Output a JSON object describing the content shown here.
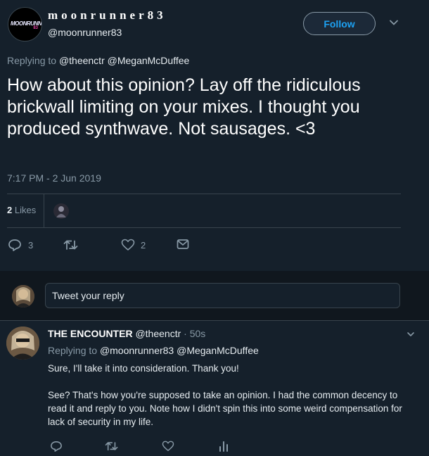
{
  "tweet": {
    "display_name": "moonrunner83",
    "handle": "@moonrunner83",
    "avatar_text": "MOONRUNNER",
    "avatar_badge": "83",
    "follow_label": "Follow",
    "replying_prefix": "Replying to",
    "replying_mentions": "@theenctr @MeganMcDuffee",
    "text": "How about this opinion? Lay off the ridiculous brickwall limiting on your mixes. I thought you produced synthwave. Not sausages. <3",
    "timestamp": "7:17 PM - 2 Jun 2019",
    "likes_count": "2",
    "likes_label": "Likes",
    "replies_count": "3",
    "like_action_count": "2"
  },
  "compose": {
    "placeholder": "Tweet your reply"
  },
  "reply": {
    "author_name": "THE ENCOUNTER",
    "author_handle": "@theenctr",
    "time": "· 50s",
    "replying_prefix": "Replying to",
    "replying_mentions": "@moonrunner83 @MeganMcDuffee",
    "paragraphs": [
      "Sure, I'll take it into consideration. Thank you!",
      "See? That's how you're supposed to take an opinion. I had the common decency to read it and reply to you. Note how I didn't spin this into some weird compensation for lack of security in my life."
    ]
  },
  "colors": {
    "background": "#15202b",
    "accent": "#1da1f2",
    "muted": "#8899a6",
    "divider": "#38444d"
  },
  "icons": [
    "caret-down-icon",
    "reply-icon",
    "retweet-icon",
    "heart-icon",
    "envelope-icon",
    "analytics-icon"
  ]
}
